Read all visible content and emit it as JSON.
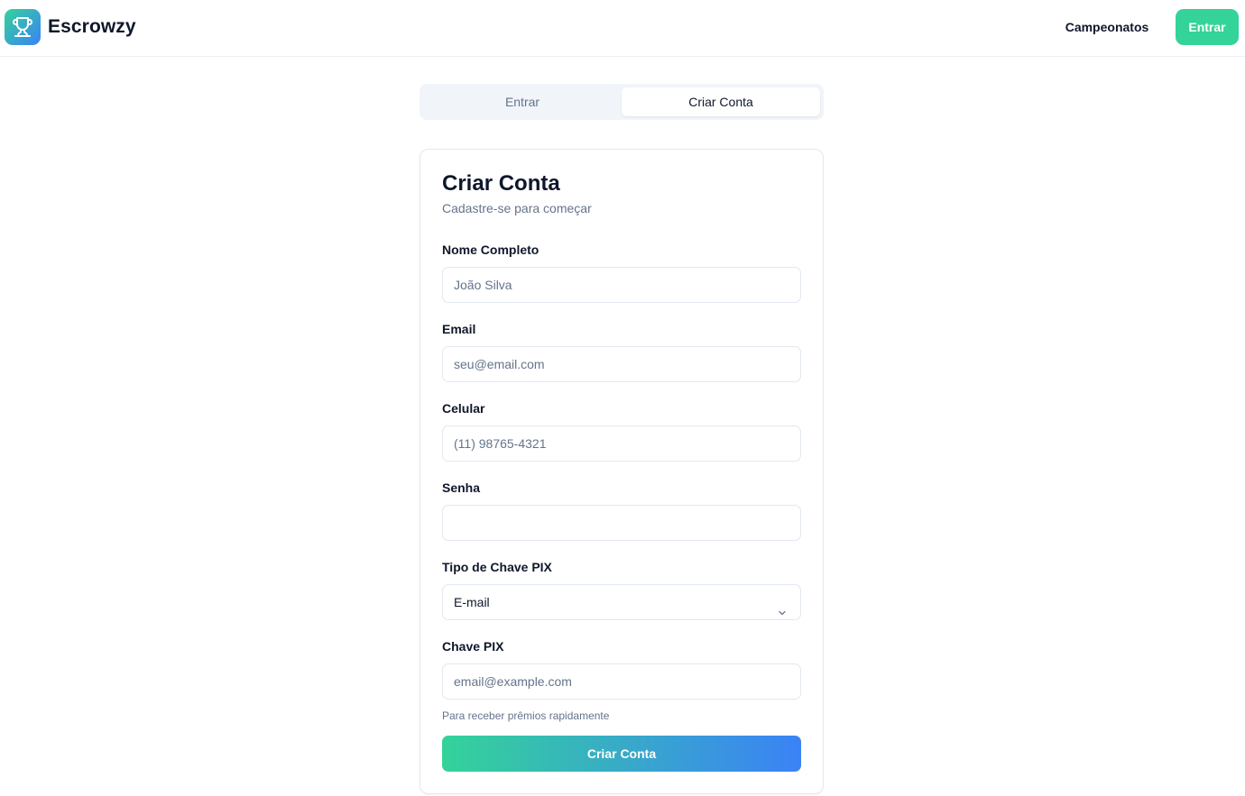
{
  "header": {
    "brand": "Escrowzy",
    "logo_icon": "trophy-icon",
    "nav_link": "Campeonatos",
    "login_button": "Entrar",
    "accent_color": "#34d399"
  },
  "tabs": [
    {
      "label": "Entrar",
      "active": false
    },
    {
      "label": "Criar Conta",
      "active": true
    }
  ],
  "form": {
    "title": "Criar Conta",
    "subtitle": "Cadastre-se para começar",
    "fields": {
      "name": {
        "label": "Nome Completo",
        "placeholder": "João Silva",
        "value": ""
      },
      "email": {
        "label": "Email",
        "placeholder": "seu@email.com",
        "value": ""
      },
      "phone": {
        "label": "Celular",
        "placeholder": "(11) 98765-4321",
        "value": ""
      },
      "password": {
        "label": "Senha",
        "placeholder": "",
        "value": ""
      },
      "pix_type": {
        "label": "Tipo de Chave PIX",
        "selected": "E-mail"
      },
      "pix_key": {
        "label": "Chave PIX",
        "placeholder": "email@example.com",
        "value": "",
        "hint": "Para receber prêmios rapidamente"
      }
    },
    "submit_label": "Criar Conta",
    "gradient": [
      "#34d399",
      "#3b82f6"
    ]
  }
}
